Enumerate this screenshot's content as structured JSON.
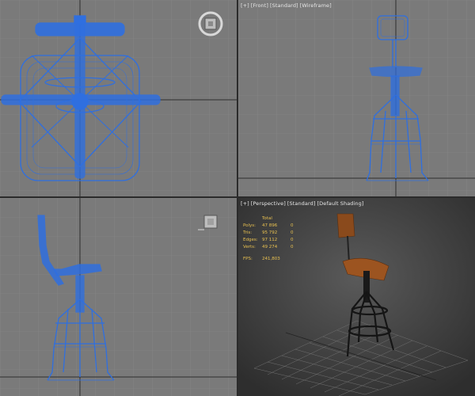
{
  "viewports": {
    "top": {
      "label_parts": []
    },
    "front": {
      "label_parts": [
        "[+]",
        "[Front]",
        "[Standard]",
        "[Wireframe]"
      ]
    },
    "left": {
      "label_parts": []
    },
    "perspective": {
      "label_parts": [
        "[+]",
        "[Perspective]",
        "[Standard]",
        "[Default Shading]"
      ]
    }
  },
  "stats": {
    "header": "Total",
    "rows": [
      {
        "name": "Polys:",
        "value": "47 896",
        "extra": "0"
      },
      {
        "name": "Tris:",
        "value": "95 792",
        "extra": "0"
      },
      {
        "name": "Edges:",
        "value": "97 112",
        "extra": "0"
      },
      {
        "name": "Verts:",
        "value": "49 274",
        "extra": "0"
      }
    ],
    "fps_label": "FPS:",
    "fps_value": "241,803"
  },
  "colors": {
    "wire": "#2f6fe0",
    "grid": "#8a8a8a",
    "axis": "#2e2e2e",
    "highlight": "#e8c050"
  }
}
